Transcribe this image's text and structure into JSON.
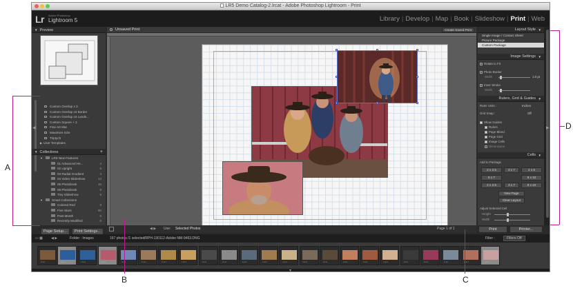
{
  "window": {
    "title": "LR5 Demo Catalog-2.lrcat - Adobe Photoshop Lightroom - Print",
    "traffic_lights": [
      "#ee5f57",
      "#f7bd41",
      "#5fc84f"
    ]
  },
  "identity": {
    "logo": "Lr",
    "vendor": "Adobe Photoshop",
    "product": "Lightroom 5"
  },
  "modules": {
    "items": [
      "Library",
      "Develop",
      "Map",
      "Book",
      "Slideshow",
      "Print",
      "Web"
    ],
    "active": "Print",
    "separator": "|"
  },
  "left_panel": {
    "preview_header": "Preview",
    "templates": [
      {
        "label": "Custom Overlap x 3",
        "count": ""
      },
      {
        "label": "Custom Overlap x3 Border",
        "count": ""
      },
      {
        "label": "Custom Overlap x3 Lands...",
        "count": ""
      },
      {
        "label": "Custom Square + 2",
        "count": ""
      },
      {
        "label": "Fine Art Mat",
        "count": ""
      },
      {
        "label": "Maximize Size",
        "count": ""
      },
      {
        "label": "Triptych",
        "count": ""
      }
    ],
    "user_templates": "User Templates",
    "collections_header": "Collections",
    "collections": [
      {
        "label": "LR5 New Features",
        "count": "",
        "level": 0
      },
      {
        "label": "01 Advanced He...",
        "count": "4",
        "level": 1
      },
      {
        "label": "02 Upright",
        "count": "6",
        "level": 1
      },
      {
        "label": "03 Radial Gradient",
        "count": "3",
        "level": 1
      },
      {
        "label": "04 Video Slideshow",
        "count": "14",
        "level": 1
      },
      {
        "label": "05 Photobook",
        "count": "15",
        "level": 1
      },
      {
        "label": "06 Photobook",
        "count": "9",
        "level": 1
      },
      {
        "label": "Tiny Slideshow",
        "count": "6",
        "level": 1
      },
      {
        "label": "Smart Collections",
        "count": "",
        "level": 0
      },
      {
        "label": "Colored Red",
        "count": "0",
        "level": 1
      },
      {
        "label": "Five Stars",
        "count": "80",
        "level": 1
      },
      {
        "label": "Past Month",
        "count": "0",
        "level": 1
      },
      {
        "label": "Recently Modified",
        "count": "0",
        "level": 1
      }
    ],
    "page_setup_label": "Page Setup...",
    "print_settings_label": "Print Settings..."
  },
  "center": {
    "title": "Unsaved Print",
    "save_button": "Create Saved Print",
    "toolbar_use_label": "Use:",
    "toolbar_use_value": "Selected Photos",
    "page_indicator": "Page 1 of 1"
  },
  "right_panel": {
    "layout_style_header": "Layout Style",
    "layout_styles": [
      "Single Image / Contact Sheet",
      "Picture Package",
      "Custom Package"
    ],
    "layout_style_selected": "Custom Package",
    "image_settings_header": "Image Settings",
    "rotate_to_fit": "Rotate to Fit",
    "photo_border": "Photo Border",
    "photo_border_width_label": "Width",
    "photo_border_width_value": "1.0 pt",
    "inner_stroke": "Inner Stroke",
    "inner_stroke_width_label": "Width",
    "rulers_header": "Rulers, Grid & Guides",
    "ruler_units_label": "Ruler Units :",
    "ruler_units_value": "Inches",
    "grid_snap_label": "Grid Snap :",
    "grid_snap_value": "Off",
    "show_guides": "Show Guides",
    "guides": [
      "Rulers",
      "Page Bleed",
      "Page Grid",
      "Image Cells",
      "Dimensions"
    ],
    "guides_checked": [
      true,
      true,
      true,
      true,
      false
    ],
    "cells_header": "Cells",
    "add_to_package": "Add to Package",
    "cell_sizes": [
      "2 x 2.5",
      "3 x 7",
      "4 x 6",
      "5 x 7",
      "8 x 10"
    ],
    "new_page": "New Page",
    "clear_layout": "Clear Layout",
    "adjust_selected_cell": "Adjust Selected Cell",
    "height_label": "Height",
    "width_label": "Width",
    "print_button": "Print",
    "printer_button": "Printer..."
  },
  "filmstrip": {
    "folder_label": "Folder : Images",
    "selection_info": "167 photos /1 selected",
    "filename": "/RPH-130112-Adobe NM-9463.DNG",
    "filter_label": "Filter :",
    "filter_value": "Filters Off",
    "thumbs": [
      {
        "color": "#7a5a3a",
        "selected": false
      },
      {
        "color": "#2d5d9a",
        "selected": true
      },
      {
        "color": "#2f5f98",
        "selected": false
      },
      {
        "color": "#b65a6e",
        "selected": true
      },
      {
        "color": "#6f88b8",
        "selected": false
      },
      {
        "color": "#9a7a5a",
        "selected": false
      },
      {
        "color": "#b08a4a",
        "selected": false
      },
      {
        "color": "#c7a060",
        "selected": false
      },
      {
        "color": "#4a4a4a",
        "selected": false
      },
      {
        "color": "#8a8a8a",
        "selected": false
      },
      {
        "color": "#5a6a7a",
        "selected": false
      },
      {
        "color": "#a07a50",
        "selected": false
      },
      {
        "color": "#c9b28a",
        "selected": false
      },
      {
        "color": "#7a6a5a",
        "selected": false
      },
      {
        "color": "#5a4a3a",
        "selected": false
      },
      {
        "color": "#c08060",
        "selected": false
      },
      {
        "color": "#a05a40",
        "selected": false
      },
      {
        "color": "#d0b090",
        "selected": false
      },
      {
        "color": "#3a3a3a",
        "selected": false
      },
      {
        "color": "#9a3a5a",
        "selected": false
      },
      {
        "color": "#7a8a9a",
        "selected": false
      },
      {
        "color": "#b07060",
        "selected": false
      },
      {
        "color": "#c8a0a0",
        "selected": true
      }
    ],
    "stars": "•••••"
  },
  "annotations": {
    "A": "A",
    "B": "B",
    "C": "C",
    "D": "D",
    "line_color": "#c0198e"
  }
}
